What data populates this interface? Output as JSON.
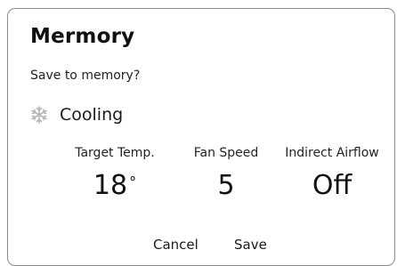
{
  "dialog": {
    "title": "Mermory",
    "prompt": "Save to memory?"
  },
  "mode": {
    "icon": "snowflake-icon",
    "label": "Cooling",
    "icon_color": "#b5b5b5"
  },
  "settings": {
    "target_temp": {
      "label": "Target Temp.",
      "value": "18",
      "unit": "°"
    },
    "fan_speed": {
      "label": "Fan Speed",
      "value": "5"
    },
    "indirect_airflow": {
      "label": "Indirect Airflow",
      "value": "Off"
    }
  },
  "actions": {
    "cancel_label": "Cancel",
    "save_label": "Save"
  }
}
